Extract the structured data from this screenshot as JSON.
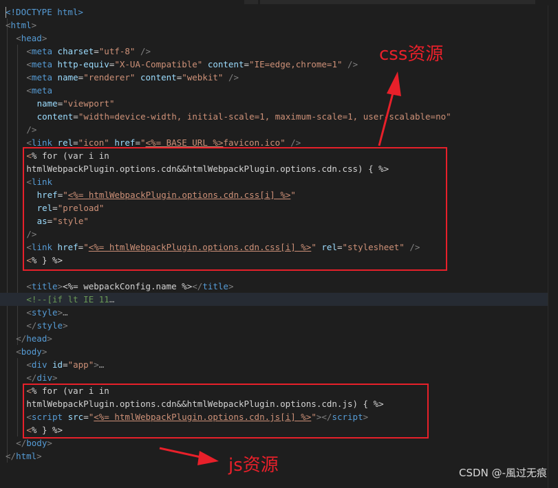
{
  "code_lines": [
    {
      "indent": 0,
      "tokens": [
        {
          "t": "<!DOCTYPE html>",
          "c": "c-doc"
        }
      ]
    },
    {
      "indent": 0,
      "tokens": [
        {
          "t": "<",
          "c": "c-br"
        },
        {
          "t": "html",
          "c": "c-tag"
        },
        {
          "t": ">",
          "c": "c-br"
        }
      ]
    },
    {
      "indent": 1,
      "tokens": [
        {
          "t": "<",
          "c": "c-br"
        },
        {
          "t": "head",
          "c": "c-tag"
        },
        {
          "t": ">",
          "c": "c-br"
        }
      ]
    },
    {
      "indent": 2,
      "tokens": [
        {
          "t": "<",
          "c": "c-br"
        },
        {
          "t": "meta",
          "c": "c-tag"
        },
        {
          "t": " charset",
          "c": "c-attr"
        },
        {
          "t": "=",
          "c": "c-txt"
        },
        {
          "t": "\"utf-8\"",
          "c": "c-str"
        },
        {
          "t": " />",
          "c": "c-br"
        }
      ]
    },
    {
      "indent": 2,
      "tokens": [
        {
          "t": "<",
          "c": "c-br"
        },
        {
          "t": "meta",
          "c": "c-tag"
        },
        {
          "t": " http-equiv",
          "c": "c-attr"
        },
        {
          "t": "=",
          "c": "c-txt"
        },
        {
          "t": "\"X-UA-Compatible\"",
          "c": "c-str"
        },
        {
          "t": " content",
          "c": "c-attr"
        },
        {
          "t": "=",
          "c": "c-txt"
        },
        {
          "t": "\"IE=edge,chrome=1\"",
          "c": "c-str"
        },
        {
          "t": " />",
          "c": "c-br"
        }
      ]
    },
    {
      "indent": 2,
      "tokens": [
        {
          "t": "<",
          "c": "c-br"
        },
        {
          "t": "meta",
          "c": "c-tag"
        },
        {
          "t": " name",
          "c": "c-attr"
        },
        {
          "t": "=",
          "c": "c-txt"
        },
        {
          "t": "\"renderer\"",
          "c": "c-str"
        },
        {
          "t": " content",
          "c": "c-attr"
        },
        {
          "t": "=",
          "c": "c-txt"
        },
        {
          "t": "\"webkit\"",
          "c": "c-str"
        },
        {
          "t": " />",
          "c": "c-br"
        }
      ]
    },
    {
      "indent": 2,
      "tokens": [
        {
          "t": "<",
          "c": "c-br"
        },
        {
          "t": "meta",
          "c": "c-tag"
        }
      ]
    },
    {
      "indent": 3,
      "tokens": [
        {
          "t": "name",
          "c": "c-attr"
        },
        {
          "t": "=",
          "c": "c-txt"
        },
        {
          "t": "\"viewport\"",
          "c": "c-str"
        }
      ]
    },
    {
      "indent": 3,
      "tokens": [
        {
          "t": "content",
          "c": "c-attr"
        },
        {
          "t": "=",
          "c": "c-txt"
        },
        {
          "t": "\"width=device-width, initial-scale=1, maximum-scale=1, user-scalable=no\"",
          "c": "c-str"
        }
      ]
    },
    {
      "indent": 2,
      "tokens": [
        {
          "t": "/>",
          "c": "c-br"
        }
      ]
    },
    {
      "indent": 2,
      "tokens": [
        {
          "t": "<",
          "c": "c-br"
        },
        {
          "t": "link",
          "c": "c-tag"
        },
        {
          "t": " rel",
          "c": "c-attr"
        },
        {
          "t": "=",
          "c": "c-txt"
        },
        {
          "t": "\"icon\"",
          "c": "c-str"
        },
        {
          "t": " href",
          "c": "c-attr"
        },
        {
          "t": "=",
          "c": "c-txt"
        },
        {
          "t": "\"",
          "c": "c-str"
        },
        {
          "t": "<%= BASE_URL %>",
          "c": "c-tmpl"
        },
        {
          "t": "favicon.ico\"",
          "c": "c-str"
        },
        {
          "t": " />",
          "c": "c-br"
        }
      ]
    },
    {
      "indent": 2,
      "tokens": [
        {
          "t": "<",
          "c": "c-delim"
        },
        {
          "t": "% for (var i in",
          "c": "c-txt"
        }
      ]
    },
    {
      "indent": 2,
      "tokens": [
        {
          "t": "htmlWebpackPlugin.options.cdn&&htmlWebpackPlugin.options.cdn.css) { %>",
          "c": "c-txt"
        }
      ]
    },
    {
      "indent": 2,
      "tokens": [
        {
          "t": "<",
          "c": "c-br"
        },
        {
          "t": "link",
          "c": "c-tag"
        }
      ]
    },
    {
      "indent": 3,
      "tokens": [
        {
          "t": "href",
          "c": "c-attr"
        },
        {
          "t": "=",
          "c": "c-txt"
        },
        {
          "t": "\"",
          "c": "c-str"
        },
        {
          "t": "<%= htmlWebpackPlugin.options.cdn.css[i] %>",
          "c": "c-tmpl"
        },
        {
          "t": "\"",
          "c": "c-str"
        }
      ]
    },
    {
      "indent": 3,
      "tokens": [
        {
          "t": "rel",
          "c": "c-attr"
        },
        {
          "t": "=",
          "c": "c-txt"
        },
        {
          "t": "\"preload\"",
          "c": "c-str"
        }
      ]
    },
    {
      "indent": 3,
      "tokens": [
        {
          "t": "as",
          "c": "c-attr"
        },
        {
          "t": "=",
          "c": "c-txt"
        },
        {
          "t": "\"style\"",
          "c": "c-str"
        }
      ]
    },
    {
      "indent": 2,
      "tokens": [
        {
          "t": "/>",
          "c": "c-br"
        }
      ]
    },
    {
      "indent": 2,
      "tokens": [
        {
          "t": "<",
          "c": "c-br"
        },
        {
          "t": "link",
          "c": "c-tag"
        },
        {
          "t": " href",
          "c": "c-attr"
        },
        {
          "t": "=",
          "c": "c-txt"
        },
        {
          "t": "\"",
          "c": "c-str"
        },
        {
          "t": "<%= htmlWebpackPlugin.options.cdn.css[i] %>",
          "c": "c-tmpl"
        },
        {
          "t": "\"",
          "c": "c-str"
        },
        {
          "t": " rel",
          "c": "c-attr"
        },
        {
          "t": "=",
          "c": "c-txt"
        },
        {
          "t": "\"stylesheet\"",
          "c": "c-str"
        },
        {
          "t": " />",
          "c": "c-br"
        }
      ]
    },
    {
      "indent": 2,
      "tokens": [
        {
          "t": "<",
          "c": "c-delim"
        },
        {
          "t": "% } %>",
          "c": "c-txt"
        }
      ]
    },
    {
      "indent": 0,
      "tokens": []
    },
    {
      "indent": 2,
      "tokens": [
        {
          "t": "<",
          "c": "c-br"
        },
        {
          "t": "title",
          "c": "c-tag"
        },
        {
          "t": ">",
          "c": "c-br"
        },
        {
          "t": "<%= webpackConfig.name %>",
          "c": "c-txt"
        },
        {
          "t": "</",
          "c": "c-br"
        },
        {
          "t": "title",
          "c": "c-tag"
        },
        {
          "t": ">",
          "c": "c-br"
        }
      ]
    },
    {
      "indent": 2,
      "hl": true,
      "tokens": [
        {
          "t": "<!--[if lt IE 11",
          "c": "c-cmt"
        },
        {
          "t": "…",
          "c": "fold"
        }
      ]
    },
    {
      "indent": 2,
      "tokens": [
        {
          "t": "<",
          "c": "c-br"
        },
        {
          "t": "style",
          "c": "c-tag"
        },
        {
          "t": ">",
          "c": "c-br"
        },
        {
          "t": "…",
          "c": "fold"
        }
      ]
    },
    {
      "indent": 2,
      "tokens": [
        {
          "t": "</",
          "c": "c-br"
        },
        {
          "t": "style",
          "c": "c-tag"
        },
        {
          "t": ">",
          "c": "c-br"
        }
      ]
    },
    {
      "indent": 1,
      "tokens": [
        {
          "t": "</",
          "c": "c-br"
        },
        {
          "t": "head",
          "c": "c-tag"
        },
        {
          "t": ">",
          "c": "c-br"
        }
      ]
    },
    {
      "indent": 1,
      "tokens": [
        {
          "t": "<",
          "c": "c-br"
        },
        {
          "t": "body",
          "c": "c-tag"
        },
        {
          "t": ">",
          "c": "c-br"
        }
      ]
    },
    {
      "indent": 2,
      "tokens": [
        {
          "t": "<",
          "c": "c-br"
        },
        {
          "t": "div",
          "c": "c-tag"
        },
        {
          "t": " id",
          "c": "c-attr"
        },
        {
          "t": "=",
          "c": "c-txt"
        },
        {
          "t": "\"app\"",
          "c": "c-str"
        },
        {
          "t": ">",
          "c": "c-br"
        },
        {
          "t": "…",
          "c": "fold"
        }
      ]
    },
    {
      "indent": 2,
      "tokens": [
        {
          "t": "</",
          "c": "c-br"
        },
        {
          "t": "div",
          "c": "c-tag"
        },
        {
          "t": ">",
          "c": "c-br"
        }
      ]
    },
    {
      "indent": 2,
      "tokens": [
        {
          "t": "<",
          "c": "c-delim"
        },
        {
          "t": "% for (var i in",
          "c": "c-txt"
        }
      ]
    },
    {
      "indent": 2,
      "tokens": [
        {
          "t": "htmlWebpackPlugin.options.cdn&&htmlWebpackPlugin.options.cdn.js) { %>",
          "c": "c-txt"
        }
      ]
    },
    {
      "indent": 2,
      "tokens": [
        {
          "t": "<",
          "c": "c-br"
        },
        {
          "t": "script",
          "c": "c-tag"
        },
        {
          "t": " src",
          "c": "c-attr"
        },
        {
          "t": "=",
          "c": "c-txt"
        },
        {
          "t": "\"",
          "c": "c-str"
        },
        {
          "t": "<%= htmlWebpackPlugin.options.cdn.js[i] %>",
          "c": "c-tmpl"
        },
        {
          "t": "\"",
          "c": "c-str"
        },
        {
          "t": ">",
          "c": "c-br"
        },
        {
          "t": "</",
          "c": "c-br"
        },
        {
          "t": "script",
          "c": "c-tag"
        },
        {
          "t": ">",
          "c": "c-br"
        }
      ]
    },
    {
      "indent": 2,
      "tokens": [
        {
          "t": "<",
          "c": "c-delim"
        },
        {
          "t": "% } %>",
          "c": "c-txt"
        }
      ]
    },
    {
      "indent": 1,
      "tokens": [
        {
          "t": "</",
          "c": "c-br"
        },
        {
          "t": "body",
          "c": "c-tag"
        },
        {
          "t": ">",
          "c": "c-br"
        }
      ]
    },
    {
      "indent": 0,
      "tokens": [
        {
          "t": "</",
          "c": "c-br"
        },
        {
          "t": "html",
          "c": "c-tag"
        },
        {
          "t": ">",
          "c": "c-br"
        }
      ]
    }
  ],
  "annotations": {
    "css_label": "css资源",
    "js_label": "js资源",
    "color": "#e8202a"
  },
  "watermark": "CSDN @-風过无痕",
  "theme": {
    "background": "#1e1e1e",
    "tag": "#569cd6",
    "attribute": "#9cdcfe",
    "string": "#ce9178",
    "comment": "#6a9955"
  }
}
